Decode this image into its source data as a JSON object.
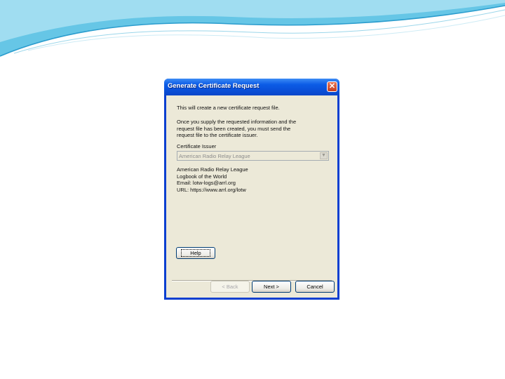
{
  "dialog": {
    "title": "Generate Certificate Request",
    "close_glyph": "✕",
    "intro": "This will create a new certificate request file.",
    "instructions": [
      "Once you supply the requested information and the",
      "request file has been created, you must send the",
      "request file to the certificate issuer."
    ],
    "issuer_label": "Certificate Issuer",
    "issuer_value": "American Radio Relay League",
    "issuer_details": [
      "American Radio Relay League",
      "Logbook of the World",
      "Email: lotw-logs@arrl.org",
      "URL: https://www.arrl.org/lotw"
    ],
    "help_label": "Help",
    "back_label": "< Back",
    "next_label": "Next >",
    "cancel_label": "Cancel"
  },
  "icons": {
    "close": "close-icon",
    "dropdown": "chevron-down-icon"
  },
  "colors": {
    "titlebar": "#0a4fd8",
    "dialog_bg": "#ece9d8",
    "slide_swoosh": "#5fc3e4"
  }
}
